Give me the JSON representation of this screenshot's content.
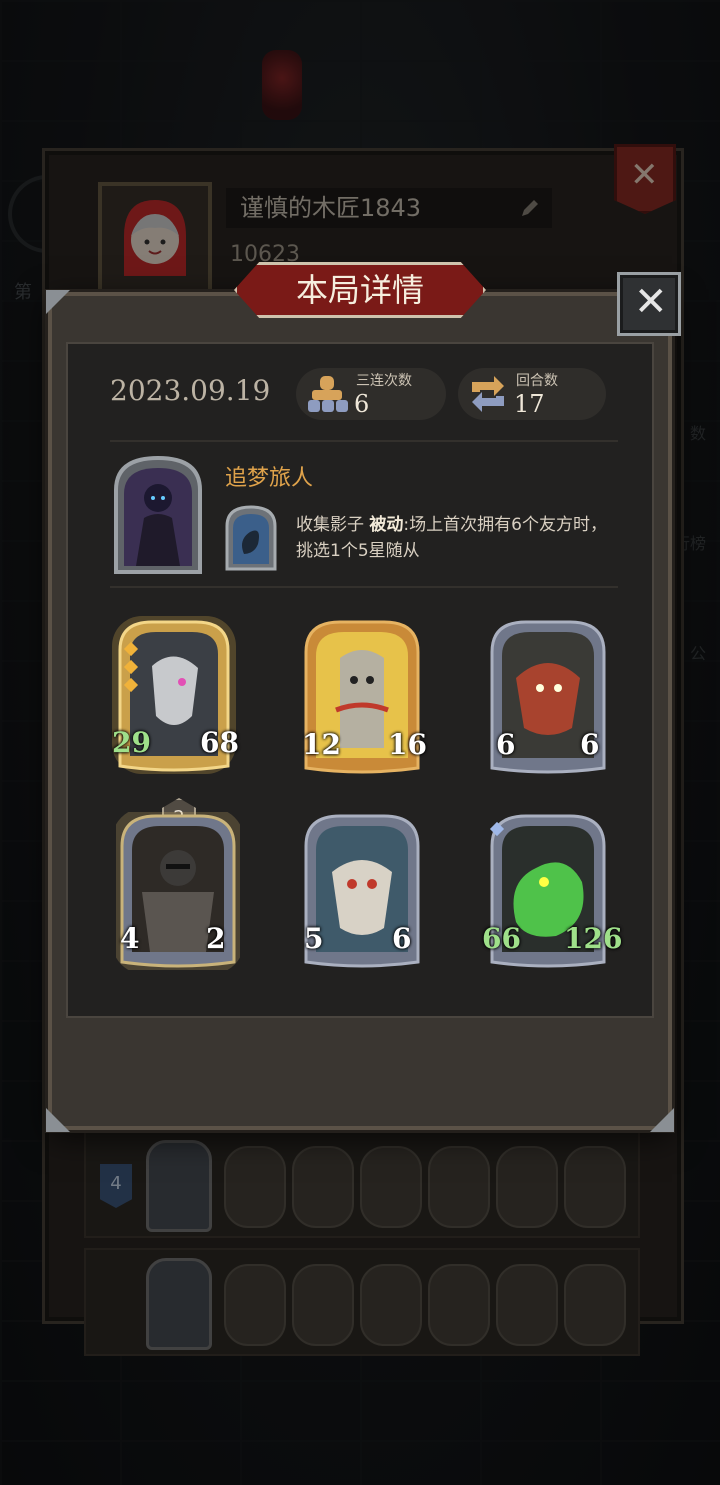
{
  "background": {
    "side_text_left": "第",
    "side_text_right": [
      "数",
      "行榜",
      "公"
    ]
  },
  "profile": {
    "player_name": "谨慎的木匠1843",
    "coins": "10623",
    "row_rank": "4"
  },
  "dialog": {
    "title": "本局详情",
    "date": "2023.09.19",
    "stats": {
      "triples_label": "三连次数",
      "triples_value": "6",
      "rounds_label": "回合数",
      "rounds_value": "17"
    },
    "hero": {
      "name": "追梦旅人",
      "skill_name": "收集影子",
      "skill_type": "被动",
      "skill_desc": ":场上首次拥有6个友方时，挑选1个5星随从"
    },
    "minions": [
      {
        "attack": "29",
        "health": "68",
        "frame": "gold"
      },
      {
        "attack": "12",
        "health": "16",
        "frame": "gold"
      },
      {
        "attack": "6",
        "health": "6",
        "frame": "silver"
      },
      {
        "attack": "4",
        "health": "2",
        "frame": "silver",
        "level": "2"
      },
      {
        "attack": "5",
        "health": "6",
        "frame": "silver"
      },
      {
        "attack": "66",
        "health": "126",
        "frame": "silver"
      }
    ]
  },
  "colors": {
    "title_banner": "#7a1a17",
    "hero_name": "#e0a34b",
    "attack": "#9fe08a",
    "health": "#ffffff"
  }
}
